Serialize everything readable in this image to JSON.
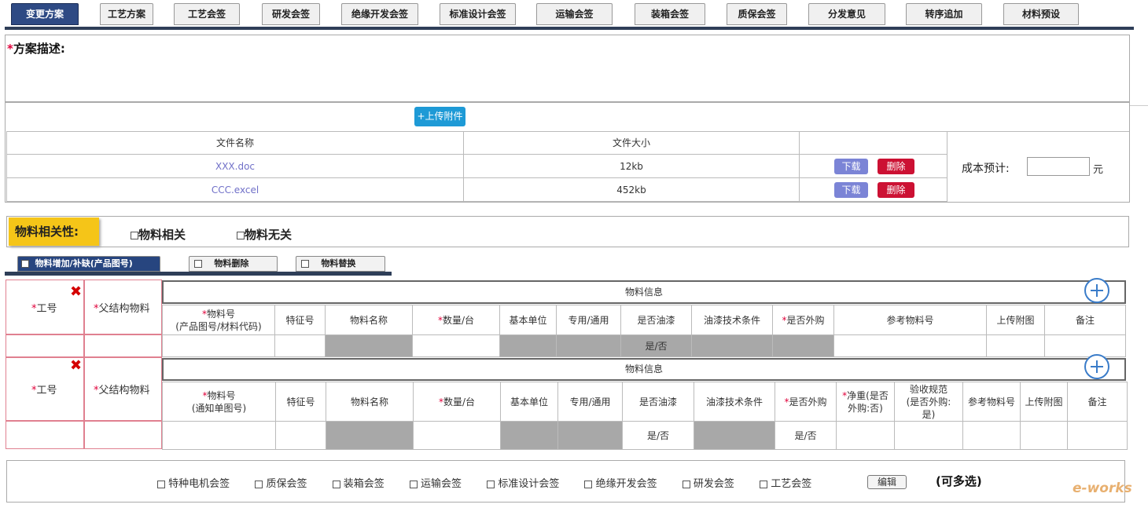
{
  "tabs": [
    {
      "label": "变更方案"
    },
    {
      "label": "工艺方案"
    },
    {
      "label": "工艺会签"
    },
    {
      "label": "研发会签"
    },
    {
      "label": "绝缘开发会签"
    },
    {
      "label": "标准设计会签"
    },
    {
      "label": "运输会签"
    },
    {
      "label": "装箱会签"
    },
    {
      "label": "质保会签"
    },
    {
      "label": "分发意见"
    },
    {
      "label": "转序追加"
    },
    {
      "label": "材料预设"
    }
  ],
  "description": {
    "label": "方案描述:",
    "required_mark": "*"
  },
  "upload": {
    "button_label": "+上传附件"
  },
  "files": {
    "headers": [
      "文件名称",
      "文件大小",
      ""
    ],
    "rows": [
      {
        "name": "XXX.doc",
        "size": "12kb"
      },
      {
        "name": "CCC.excel",
        "size": "452kb"
      }
    ],
    "download_label": "下载",
    "delete_label": "删除"
  },
  "cost": {
    "label": "成本预计:",
    "value": "",
    "unit": "元"
  },
  "relevance": {
    "label": "物料相关性:",
    "option_related": "物料相关",
    "option_unrelated": "物料无关"
  },
  "subtabs": [
    {
      "label": "物料增加/补缺(产品图号)"
    },
    {
      "label": "物料删除"
    },
    {
      "label": "物料替换"
    }
  ],
  "block1": {
    "left_headers": [
      "工号",
      "父结构物料"
    ],
    "group_title": "物料信息",
    "columns": [
      "物料号\n(产品图号/材料代码)",
      "特征号",
      "物料名称",
      "数量/台",
      "基本单位",
      "专用/通用",
      "是否油漆",
      "油漆技术条件",
      "是否外购",
      "参考物料号",
      "上传附图",
      "备注"
    ],
    "row_values": [
      "",
      "",
      "",
      "",
      "",
      "",
      "是/否",
      "",
      "",
      "",
      "",
      ""
    ]
  },
  "block2": {
    "left_headers": [
      "工号",
      "父结构物料"
    ],
    "group_title": "物料信息",
    "columns": [
      "物料号\n(通知单图号)",
      "特征号",
      "物料名称",
      "数量/台",
      "基本单位",
      "专用/通用",
      "是否油漆",
      "油漆技术条件",
      "是否外购",
      "净重(是否\n外购:否)",
      "验收规范\n(是否外购:\n是)",
      "参考物料号",
      "上传附图",
      "备注"
    ],
    "row_values": [
      "",
      "",
      "",
      "",
      "",
      "",
      "是/否",
      "",
      "是/否",
      "",
      "",
      "",
      "",
      ""
    ]
  },
  "signoffs": {
    "items": [
      "特种电机会签",
      "质保会签",
      "装箱会签",
      "运输会签",
      "标准设计会签",
      "绝缘开发会签",
      "研发会签",
      "工艺会签"
    ],
    "edit_label": "编辑",
    "note": "(可多选)"
  },
  "watermark": "e-works",
  "colors": {
    "tab_active": "#2e4a84",
    "required": "#e0003a",
    "highlight": "#f5c518",
    "download": "#7b84d6",
    "delete": "#cc1133",
    "upload": "#1e9ad6"
  }
}
